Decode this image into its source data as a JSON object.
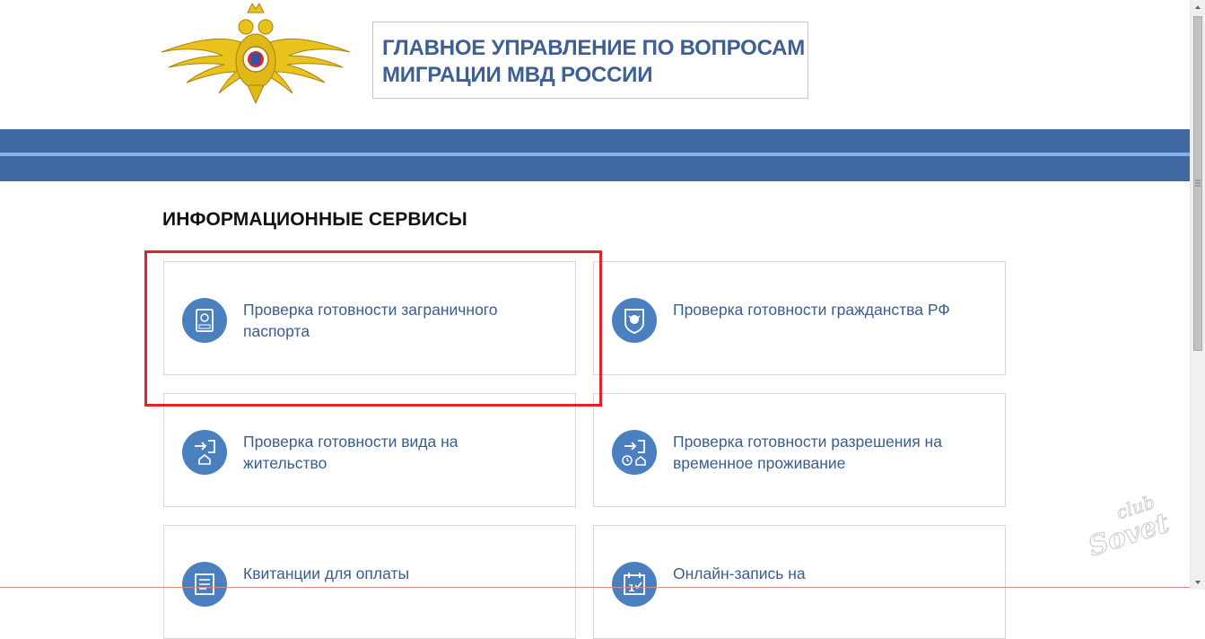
{
  "header": {
    "title_line1": "ГЛАВНОЕ УПРАВЛЕНИЕ ПО ВОПРОСАМ",
    "title_line2": "МИГРАЦИИ МВД РОССИИ",
    "emblem_icon": "double-headed-eagle-emblem"
  },
  "colors": {
    "brand_blue": "#3f67a0",
    "band_stripe": "#82b1ec",
    "title_text": "#3d5f94",
    "icon_circle": "#4a80c0",
    "highlight": "#e2232d"
  },
  "services": {
    "section_title": "ИНФОРМАЦИОННЫЕ СЕРВИСЫ",
    "items": [
      {
        "label": "Проверка готовности заграничного паспорта",
        "icon": "passport-icon"
      },
      {
        "label": "Проверка готовности гражданства РФ",
        "icon": "coat-of-arms-icon"
      },
      {
        "label": "Проверка готовности вида на жительство",
        "icon": "entry-home-icon"
      },
      {
        "label": "Проверка готовности разрешения на временное проживание",
        "icon": "entry-clock-home-icon"
      },
      {
        "label": "Квитанции для оплаты",
        "icon": "receipt-icon"
      },
      {
        "label": "Онлайн-запись на",
        "icon": "calendar-icon"
      }
    ]
  },
  "watermark": {
    "line1": "club",
    "line2": "Sovet"
  }
}
